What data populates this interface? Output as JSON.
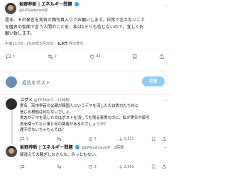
{
  "main_post": {
    "author_name": "坂野养新 | エネルギー問題",
    "handle": "@LPGadvisorJP",
    "text_lines": [
      "是非、その発言を実名と顔写真入りでお願いします。日常で言えないこと",
      "を匿名の仮面で言う人間のことを、私は1ミリも信じないので。宜しくお",
      "願い致します。"
    ],
    "time": "午後11:55 · 2026年5月30日",
    "views_count": "1.3万",
    "views_label": "件の表示",
    "actions": {
      "reply": "3",
      "retweet": "2",
      "like": "41",
      "bookmark": ""
    }
  },
  "reply_box": {
    "placeholder": "返信をポスト",
    "button": "返信"
  },
  "reply1": {
    "author_name": "ユグ✕",
    "handle": "@TF36m7",
    "time": "· 21時間",
    "text_lines": [
      "実名、高市早苗の父親が韓国人というデマを流したのは貴方たちのに",
      "信じる根拠は何もないでしょ。",
      "貴方がデマを流したのはポストを消しても残る事実なのに、私が実名や顔写",
      "真を使ってない事と何の関連があるのでしょうか？",
      "理不尽ないちゃもんでは？"
    ],
    "actions": {
      "reply": "1",
      "retweet": "",
      "like": "7",
      "views": "3,421"
    }
  },
  "reply2": {
    "author_name": "坂野养新 | エネルギー問題",
    "handle": "@LPGadvisorJP",
    "time": "· 1時間",
    "text_lines": [
      "疑違えて大騒ぎしなさんな、みっともない。"
    ],
    "actions": {
      "reply": "",
      "retweet": "",
      "like": "3",
      "views": "2,965"
    }
  }
}
